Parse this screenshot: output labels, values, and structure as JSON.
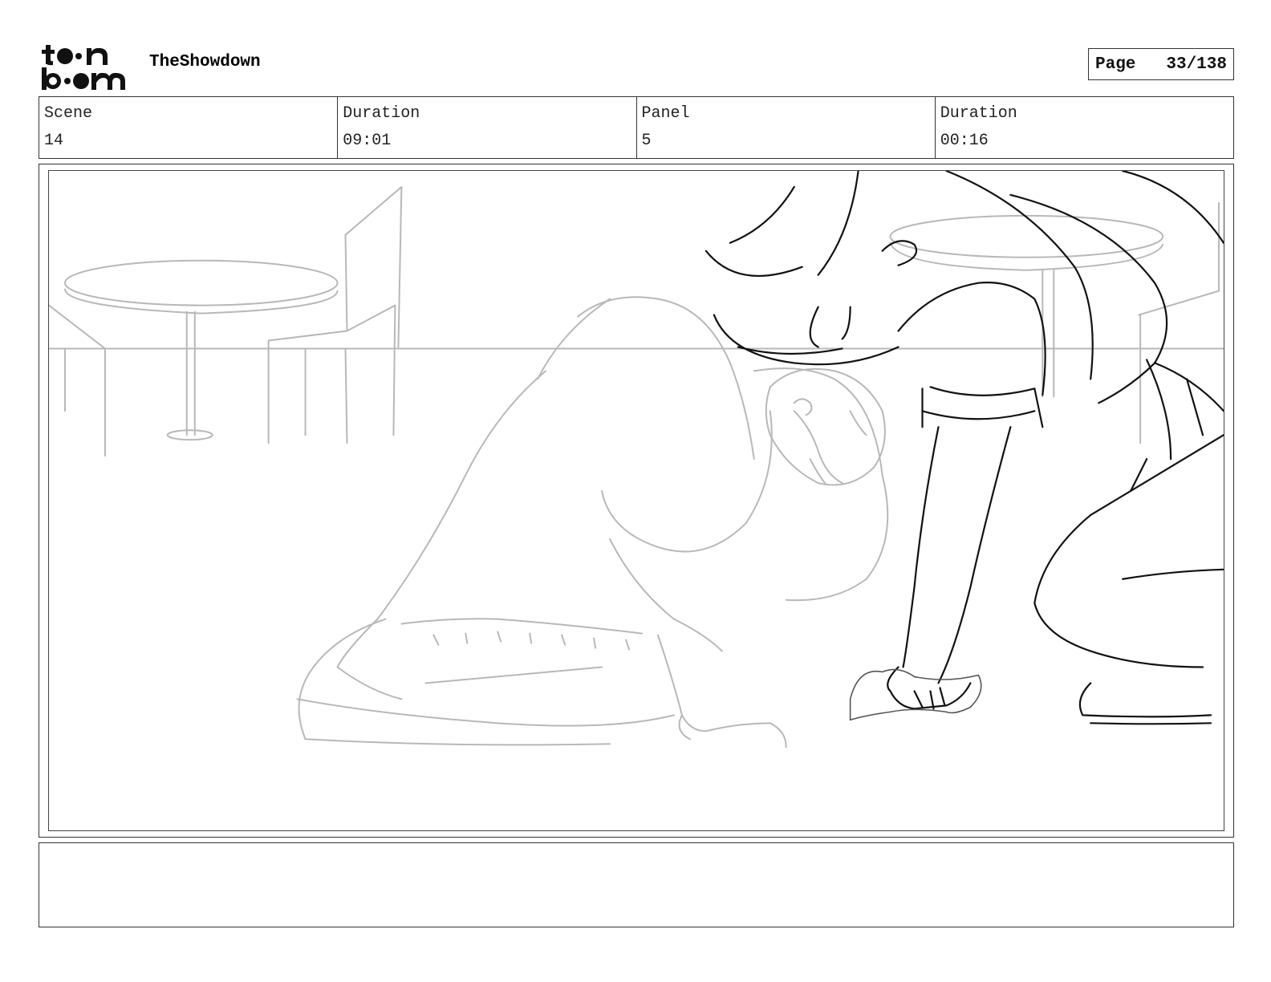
{
  "header": {
    "logo_alt": "toon boom",
    "project_title": "TheShowdown",
    "page_label": "Page",
    "page_number": "33/138"
  },
  "info": {
    "scene_label": "Scene",
    "scene_value": "14",
    "scene_duration_label": "Duration",
    "scene_duration_value": "09:01",
    "panel_label": "Panel",
    "panel_value": "5",
    "panel_duration_label": "Duration",
    "panel_duration_value": "00:16"
  },
  "panel": {
    "image_icon": "storyboard-sketch-icon"
  },
  "notes": {
    "text": ""
  }
}
